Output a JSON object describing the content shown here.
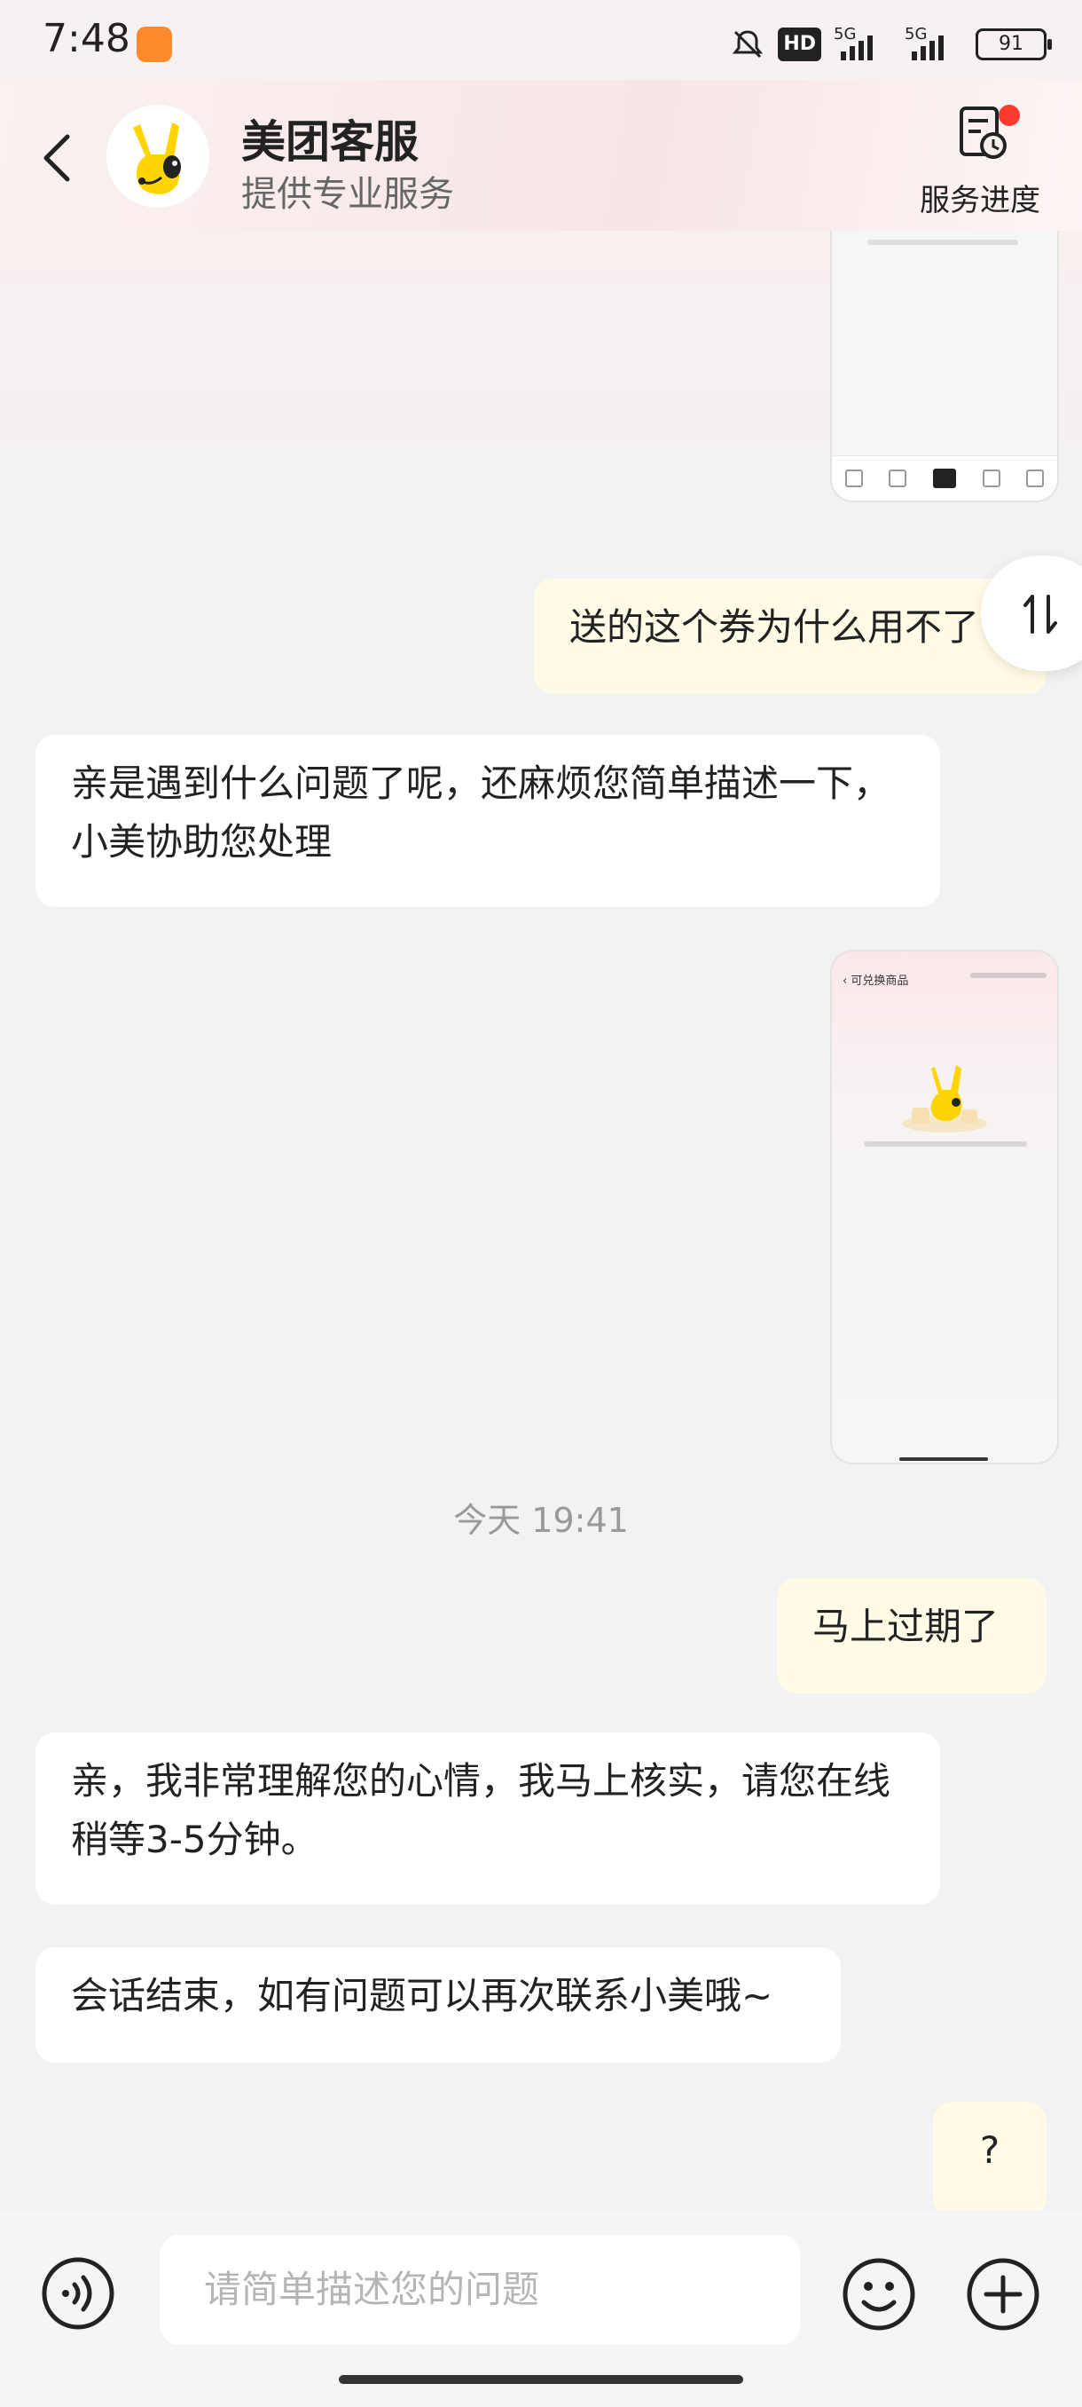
{
  "status_bar": {
    "time": "7:48",
    "hd_label": "HD",
    "network_1": "5G",
    "network_2": "5G",
    "battery": "91"
  },
  "header": {
    "title": "美团客服",
    "subtitle": "提供专业服务",
    "progress_label": "服务进度"
  },
  "messages": [
    {
      "role": "user",
      "type": "image"
    },
    {
      "role": "user",
      "type": "text",
      "text": "送的这个券为什么用不了"
    },
    {
      "role": "agent",
      "type": "text",
      "text": "亲是遇到什么问题了呢，还麻烦您简单描述一下，小美协助您处理"
    },
    {
      "role": "user",
      "type": "image",
      "caption_header": "可兑换商品"
    },
    {
      "role": "system",
      "type": "timestamp",
      "text": "今天 19:41"
    },
    {
      "role": "user",
      "type": "text",
      "text": "马上过期了"
    },
    {
      "role": "agent",
      "type": "text",
      "text": "亲，我非常理解您的心情，我马上核实，请您在线稍等3-5分钟。"
    },
    {
      "role": "agent",
      "type": "text",
      "text": "会话结束，如有问题可以再次联系小美哦~"
    },
    {
      "role": "user",
      "type": "text",
      "text": "?"
    }
  ],
  "input": {
    "placeholder": "请简单描述您的问题"
  },
  "colors": {
    "user_bubble": "#fffbe6",
    "agent_bubble": "#ffffff",
    "background": "#f2f2f2",
    "badge_red": "#ff3b30"
  },
  "icons": [
    "back-arrow-icon",
    "service-progress-icon",
    "swap-icon",
    "voice-icon",
    "emoji-icon",
    "plus-icon"
  ]
}
